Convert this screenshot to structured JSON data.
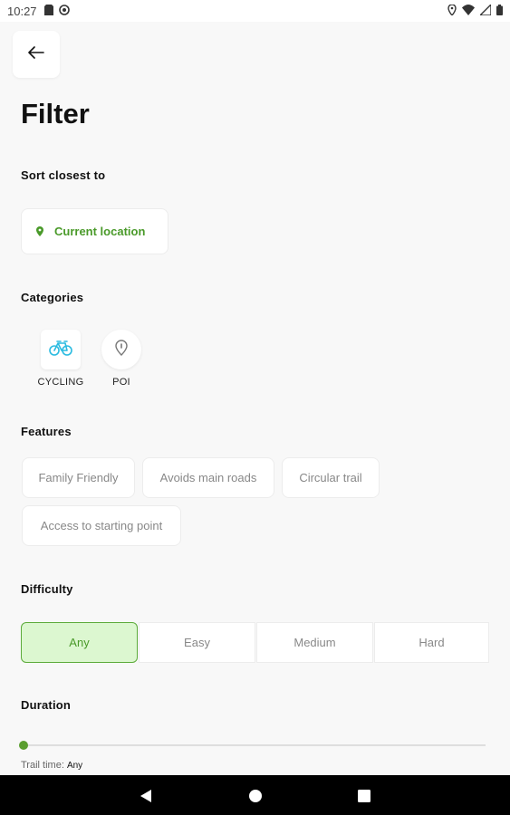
{
  "status_bar": {
    "time": "10:27",
    "left_icons": [
      "sd-card-icon",
      "at-icon"
    ],
    "right_icons": [
      "location-icon",
      "wifi-icon",
      "signal-icon",
      "battery-icon"
    ]
  },
  "header": {
    "back_icon": "arrow-left-icon",
    "title": "Filter"
  },
  "sort": {
    "label": "Sort closest to",
    "location_button": "Current location",
    "location_icon": "map-pin-icon"
  },
  "categories": {
    "label": "Categories",
    "items": [
      {
        "label": "CYCLING",
        "icon": "bicycle-icon",
        "color": "#2bbbe0"
      },
      {
        "label": "POI",
        "icon": "poi-pin-icon",
        "color": "#777777"
      }
    ]
  },
  "features": {
    "label": "Features",
    "chips": [
      "Family Friendly",
      "Avoids main roads",
      "Circular trail",
      "Access to starting point"
    ]
  },
  "difficulty": {
    "label": "Difficulty",
    "options": [
      "Any",
      "Easy",
      "Medium",
      "Hard"
    ],
    "selected": "Any"
  },
  "duration": {
    "label": "Duration",
    "trail_time_label": "Trail time:",
    "trail_time_value": "Any",
    "slider_value": 0
  },
  "colors": {
    "accent_green": "#4a9a2a",
    "selected_bg": "#dcf7d0",
    "cycling_blue": "#2bbbe0"
  },
  "nav_bar": {
    "icons": [
      "back-triangle-icon",
      "home-circle-icon",
      "recents-square-icon"
    ]
  }
}
